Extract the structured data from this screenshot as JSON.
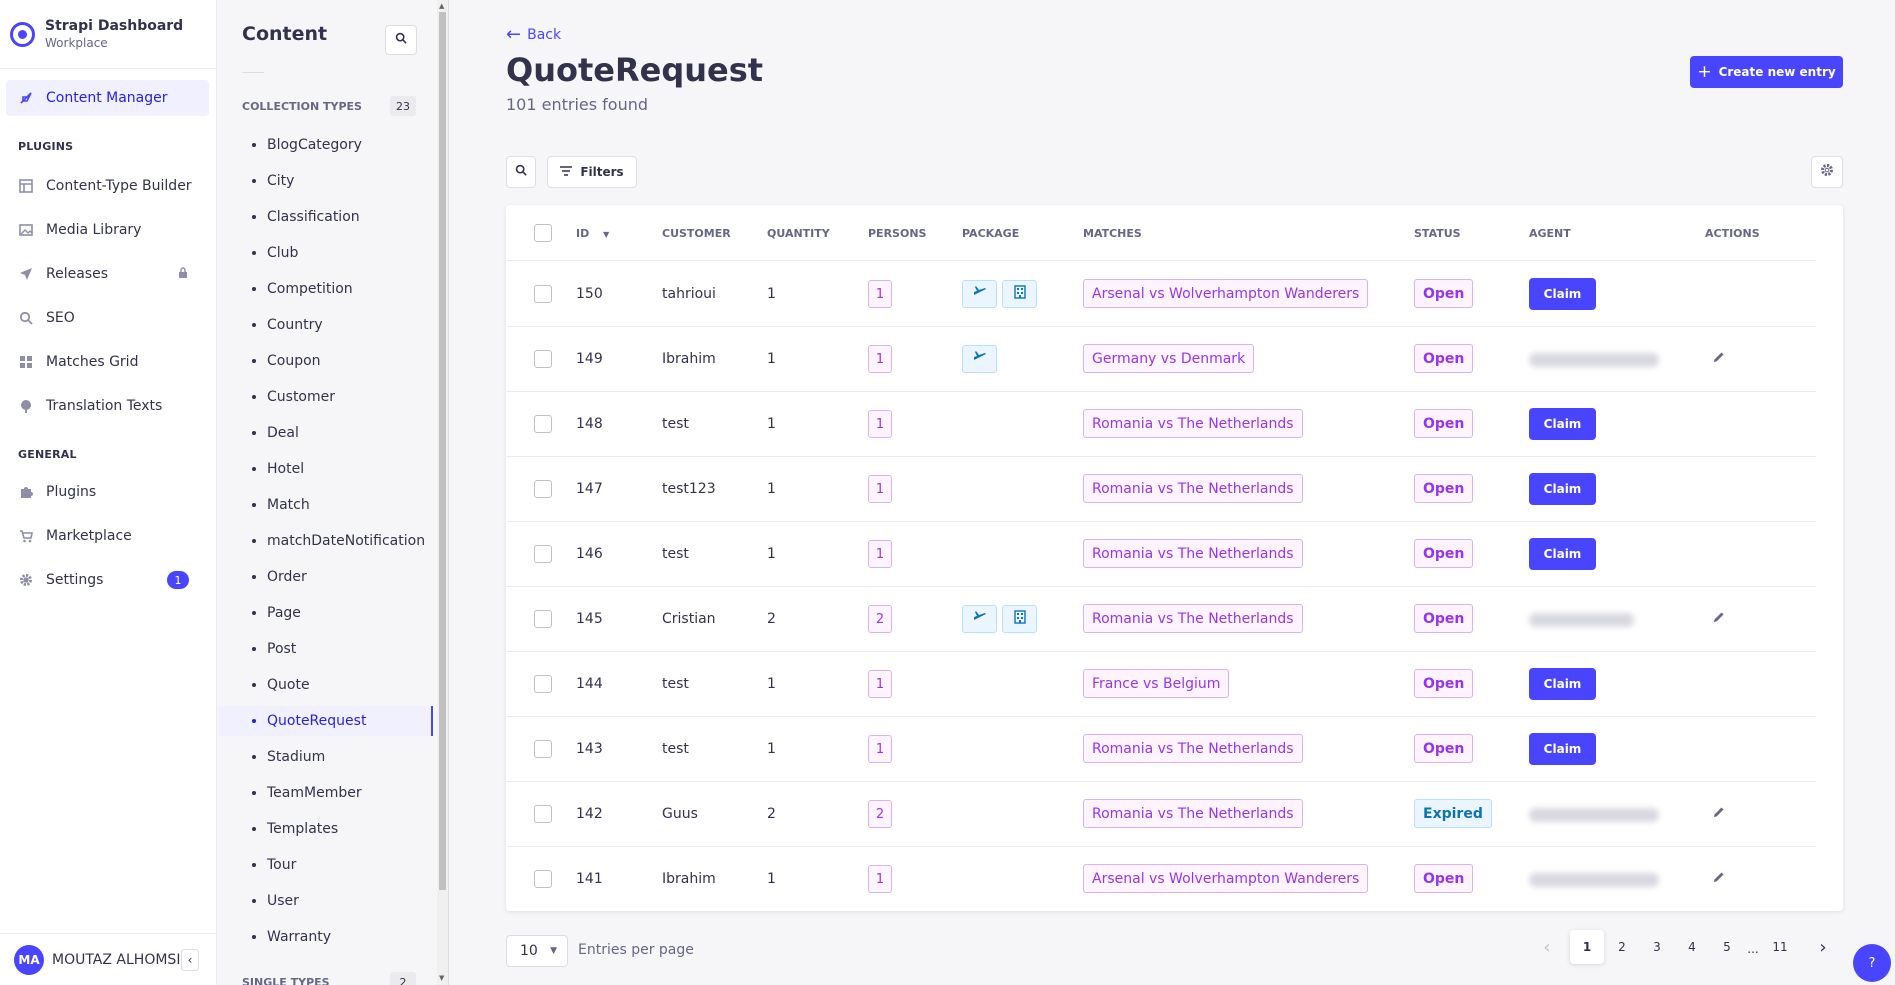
{
  "brand": {
    "title": "Strapi Dashboard",
    "subtitle": "Workplace"
  },
  "mainnav": {
    "content_manager": "Content Manager",
    "plugins_label": "PLUGINS",
    "plugins": [
      "Content-Type Builder",
      "Media Library",
      "Releases",
      "SEO",
      "Matches Grid",
      "Translation Texts"
    ],
    "general_label": "GENERAL",
    "general": [
      "Plugins",
      "Marketplace",
      "Settings"
    ],
    "settings_badge": "1",
    "user_initials": "MA",
    "user_name": "MOUTAZ ALHOMSI"
  },
  "subnav": {
    "title": "Content",
    "collection_label": "COLLECTION TYPES",
    "collection_count": "23",
    "items": [
      "BlogCategory",
      "City",
      "Classification",
      "Club",
      "Competition",
      "Country",
      "Coupon",
      "Customer",
      "Deal",
      "Hotel",
      "Match",
      "matchDateNotification",
      "Order",
      "Page",
      "Post",
      "Quote",
      "QuoteRequest",
      "Stadium",
      "TeamMember",
      "Templates",
      "Tour",
      "User",
      "Warranty"
    ],
    "active_item": "QuoteRequest",
    "single_label": "SINGLE TYPES",
    "single_count": "2"
  },
  "header": {
    "back": "Back",
    "title": "QuoteRequest",
    "subtitle": "101 entries found",
    "create": "Create new entry"
  },
  "toolbar": {
    "filters": "Filters"
  },
  "table": {
    "columns": [
      "ID",
      "CUSTOMER",
      "QUANTITY",
      "PERSONS",
      "PACKAGE",
      "MATCHES",
      "STATUS",
      "AGENT",
      "ACTIONS"
    ],
    "claim_label": "Claim",
    "rows": [
      {
        "id": "150",
        "customer": "tahrioui",
        "quantity": "1",
        "persons": "1",
        "package": [
          "flight",
          "hotel"
        ],
        "match": "Arsenal vs Wolverhampton Wanderers",
        "status": "Open",
        "agent": "claim"
      },
      {
        "id": "149",
        "customer": "Ibrahim",
        "quantity": "1",
        "persons": "1",
        "package": [
          "flight"
        ],
        "match": "Germany vs Denmark",
        "status": "Open",
        "agent": "assigned"
      },
      {
        "id": "148",
        "customer": "test",
        "quantity": "1",
        "persons": "1",
        "package": [],
        "match": "Romania vs The Netherlands",
        "status": "Open",
        "agent": "claim"
      },
      {
        "id": "147",
        "customer": "test123",
        "quantity": "1",
        "persons": "1",
        "package": [],
        "match": "Romania vs The Netherlands",
        "status": "Open",
        "agent": "claim"
      },
      {
        "id": "146",
        "customer": "test",
        "quantity": "1",
        "persons": "1",
        "package": [],
        "match": "Romania vs The Netherlands",
        "status": "Open",
        "agent": "claim"
      },
      {
        "id": "145",
        "customer": "Cristian",
        "quantity": "2",
        "persons": "2",
        "package": [
          "flight",
          "hotel"
        ],
        "match": "Romania vs The Netherlands",
        "status": "Open",
        "agent": "assigned"
      },
      {
        "id": "144",
        "customer": "test",
        "quantity": "1",
        "persons": "1",
        "package": [],
        "match": "France vs Belgium",
        "status": "Open",
        "agent": "claim"
      },
      {
        "id": "143",
        "customer": "test",
        "quantity": "1",
        "persons": "1",
        "package": [],
        "match": "Romania vs The Netherlands",
        "status": "Open",
        "agent": "claim"
      },
      {
        "id": "142",
        "customer": "Guus",
        "quantity": "2",
        "persons": "2",
        "package": [],
        "match": "Romania vs The Netherlands",
        "status": "Expired",
        "agent": "assigned"
      },
      {
        "id": "141",
        "customer": "Ibrahim",
        "quantity": "1",
        "persons": "1",
        "package": [],
        "match": "Arsenal vs Wolverhampton Wanderers",
        "status": "Open",
        "agent": "assigned"
      }
    ]
  },
  "pagination": {
    "per_page": "10",
    "per_page_label": "Entries per page",
    "pages": [
      "1",
      "2",
      "3",
      "4",
      "5",
      "...",
      "11"
    ],
    "current": "1"
  },
  "help": "?",
  "colors": {
    "primary": "#4945ff",
    "alternative": "#9736e8",
    "secondary": "#0c75af"
  }
}
